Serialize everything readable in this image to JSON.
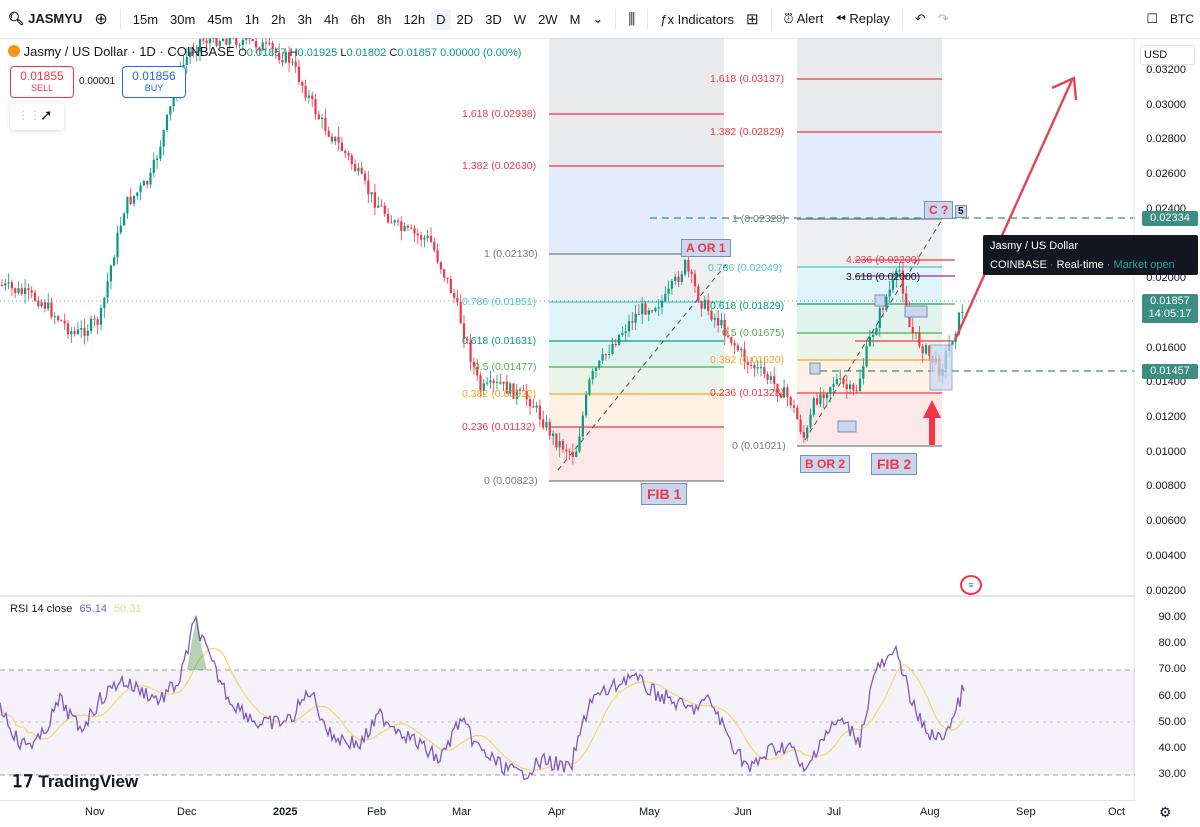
{
  "toolbar": {
    "symbol": "JASMYU",
    "intervals": [
      "15m",
      "30m",
      "45m",
      "1h",
      "2h",
      "3h",
      "4h",
      "6h",
      "8h",
      "12h",
      "D",
      "2W",
      "3D",
      "W",
      "M"
    ],
    "interval_labels": {
      "i15m": "15m",
      "i30m": "30m",
      "i45m": "45m",
      "i1h": "1h",
      "i2h": "2h",
      "i3h": "3h",
      "i4h": "4h",
      "i6h": "6h",
      "i8h": "8h",
      "i12h": "12h",
      "iD": "D",
      "i2D": "2D",
      "i3D": "3D",
      "iW": "W",
      "i2W": "2W",
      "iM": "M"
    },
    "active_interval": "D",
    "indicators_label": "Indicators",
    "alert_label": "Alert",
    "replay_label": "Replay",
    "right_label": "BTC"
  },
  "legend": {
    "title": "Jasmy / US Dollar · 1D · COINBASE",
    "o_label": "O",
    "o_value": "0.01857",
    "h_label": "H",
    "h_value": "0.01925",
    "l_label": "L",
    "l_value": "0.01802",
    "c_label": "C",
    "c_value": "0.01857",
    "change": "0.00000 (0.00%)",
    "sell_price": "0.01855",
    "sell_label": "SELL",
    "spread": "0.00001",
    "buy_price": "0.01856",
    "buy_label": "BUY"
  },
  "currency": "USD",
  "price_axis": [
    "0.03200",
    "0.03000",
    "0.02800",
    "0.02600",
    "0.02400",
    "0.02200",
    "0.02000",
    "0.01800",
    "0.01600",
    "0.01400",
    "0.01200",
    "0.01000",
    "0.00800",
    "0.00600",
    "0.00400",
    "0.00200"
  ],
  "price_badges": {
    "dashed_level": "0.02334",
    "last_price": "0.01857",
    "countdown": "14:05:17",
    "support_level": "0.01457"
  },
  "tooltip": {
    "title": "Jasmy / US Dollar",
    "exchange": "COINBASE",
    "mode": "Real-time",
    "status": "Market open"
  },
  "fib1": {
    "tag": "FIB 1",
    "levels": [
      {
        "label": "1.618 (0.02938)",
        "color": "#f23645"
      },
      {
        "label": "1.382 (0.02630)",
        "color": "#f23645"
      },
      {
        "label": "1 (0.02130)",
        "color": "#787b86"
      },
      {
        "label": "0.786 (0.01851)",
        "color": "#4dc6c6"
      },
      {
        "label": "0.618 (0.01631)",
        "color": "#089981"
      },
      {
        "label": "0.5 (0.01477)",
        "color": "#4caf50"
      },
      {
        "label": "0.382 (0.01322)",
        "color": "#f5a623"
      },
      {
        "label": "0.236 (0.01132)",
        "color": "#f23645"
      },
      {
        "label": "0 (0.00823)",
        "color": "#787b86"
      }
    ]
  },
  "fib2": {
    "tag": "FIB 2",
    "levels": [
      {
        "label": "1.618 (0.03137)",
        "color": "#f23645"
      },
      {
        "label": "1.382 (0.02829)",
        "color": "#f23645"
      },
      {
        "label": "1 (0.02328)",
        "color": "#787b86"
      },
      {
        "label": "4.236 (0.02200)",
        "color": "#f23645"
      },
      {
        "label": "0.786 (0.02049)",
        "color": "#4dc6c6"
      },
      {
        "label": "3.618 (0.02000)",
        "color": "#9c27b0"
      },
      {
        "label": "0.618 (0.01829)",
        "color": "#089981"
      },
      {
        "label": "0.5 (0.01675)",
        "color": "#4caf50"
      },
      {
        "label": "0.382 (0.01520)",
        "color": "#f5a623"
      },
      {
        "label": "0.236 (0.01328)",
        "color": "#f23645"
      },
      {
        "label": "0 (0.01021)",
        "color": "#787b86"
      }
    ]
  },
  "wave_tags": {
    "a_or_1": "A OR 1",
    "b_or_2": "B OR 2",
    "c_q": "C ?",
    "five": "5"
  },
  "rsi": {
    "label": "RSI 14 close",
    "value": "65.14",
    "ma_value": "50.31",
    "axis": [
      "90.00",
      "80.00",
      "70.00",
      "60.00",
      "50.00",
      "40.00",
      "30.00"
    ]
  },
  "time_axis": [
    "Nov",
    "Dec",
    "2025",
    "Feb",
    "Mar",
    "Apr",
    "May",
    "Jun",
    "Jul",
    "Aug",
    "Sep",
    "Oct"
  ],
  "brand": "TradingView",
  "colors": {
    "up": "#089981",
    "down": "#f23645",
    "rsi": "#7e57c2",
    "rsi_ma": "#f5d76e",
    "accent": "#2962ff"
  }
}
